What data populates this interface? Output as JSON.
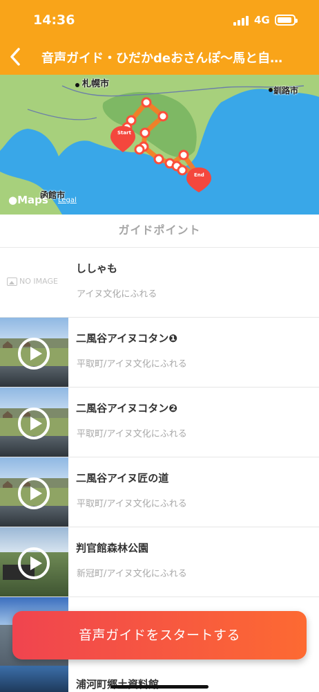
{
  "status_bar": {
    "time": "14:36",
    "network": "4G"
  },
  "nav": {
    "title": "音声ガイド・ひだかdeおさんぽ〜馬と自…"
  },
  "map": {
    "labels": {
      "sapporo": "札幌市",
      "kushiro": "釧路市",
      "hakodate": "函館市"
    },
    "start_label": "Start",
    "end_label": "End",
    "attribution": "Maps",
    "legal": "Legal",
    "route_color": "#fb7a22",
    "water_color": "#39a7e8",
    "land_color": "#a7d07c"
  },
  "section": {
    "header": "ガイドポイント"
  },
  "list": {
    "no_image_text": "NO IMAGE",
    "items": [
      {
        "title": "ししゃも",
        "subtitle": "アイヌ文化にふれる",
        "has_image": false
      },
      {
        "title": "二風谷アイヌコタン❶",
        "subtitle": "平取町/アイヌ文化にふれる",
        "has_image": true
      },
      {
        "title": "二風谷アイヌコタン❷",
        "subtitle": "平取町/アイヌ文化にふれる",
        "has_image": true
      },
      {
        "title": "二風谷アイヌ匠の道",
        "subtitle": "平取町/アイヌ文化にふれる",
        "has_image": true
      },
      {
        "title": "判官館森林公園",
        "subtitle": "新冠町/アイヌ文化にふれる",
        "has_image": true
      },
      {
        "title": "浦河町郷土資料館",
        "subtitle": "",
        "has_image": true
      }
    ]
  },
  "actions": {
    "start_button": "音声ガイドをスタートする"
  },
  "colors": {
    "accent": "#f9a419",
    "button_start": "#f0444f",
    "button_end": "#fd6a32"
  }
}
